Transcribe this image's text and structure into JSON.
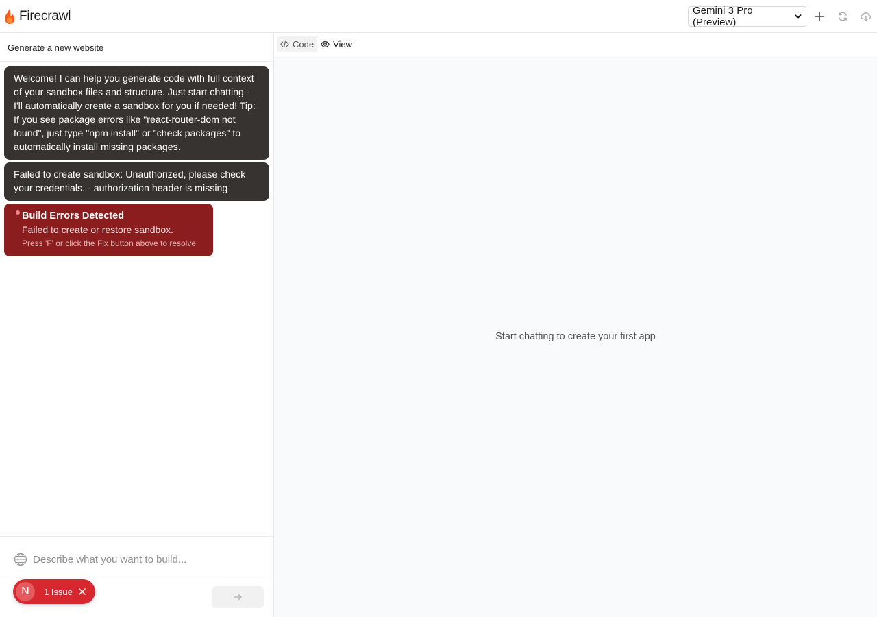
{
  "app": {
    "name": "Firecrawl",
    "brand_color": "#fa5d19"
  },
  "header": {
    "model_select": {
      "selected": "Gemini 3 Pro (Preview)"
    },
    "buttons": [
      {
        "name": "new-project",
        "icon": "plus-icon"
      },
      {
        "name": "refresh",
        "icon": "refresh-icon"
      },
      {
        "name": "download",
        "icon": "cloud-download-icon"
      }
    ]
  },
  "sidebar": {
    "title": "Generate a new website",
    "messages": [
      {
        "text": "Welcome! I can help you generate code with full context of your sandbox files and structure. Just start chatting - I'll automatically create a sandbox for you if needed! Tip: If you see package errors like \"react-router-dom not found\", just type \"npm install\" or \"check packages\" to automatically install missing packages."
      },
      {
        "text": "Failed to create sandbox: Unauthorized, please check your credentials. - authorization header is missing"
      }
    ],
    "error": {
      "title": "Build Errors Detected",
      "message": "Failed to create or restore sandbox.",
      "hint": "Press 'F' or click the Fix button above to resolve"
    },
    "input": {
      "placeholder": "Describe what you want to build...",
      "value": ""
    },
    "issue_badge": {
      "avatar": "N",
      "label": "1 Issue",
      "color": "#d8282f"
    }
  },
  "preview": {
    "tabs": [
      {
        "label": "Code",
        "icon": "code-icon",
        "active": false
      },
      {
        "label": "View",
        "icon": "eye-icon",
        "active": true
      }
    ],
    "empty_message": "Start chatting to create your first app"
  }
}
